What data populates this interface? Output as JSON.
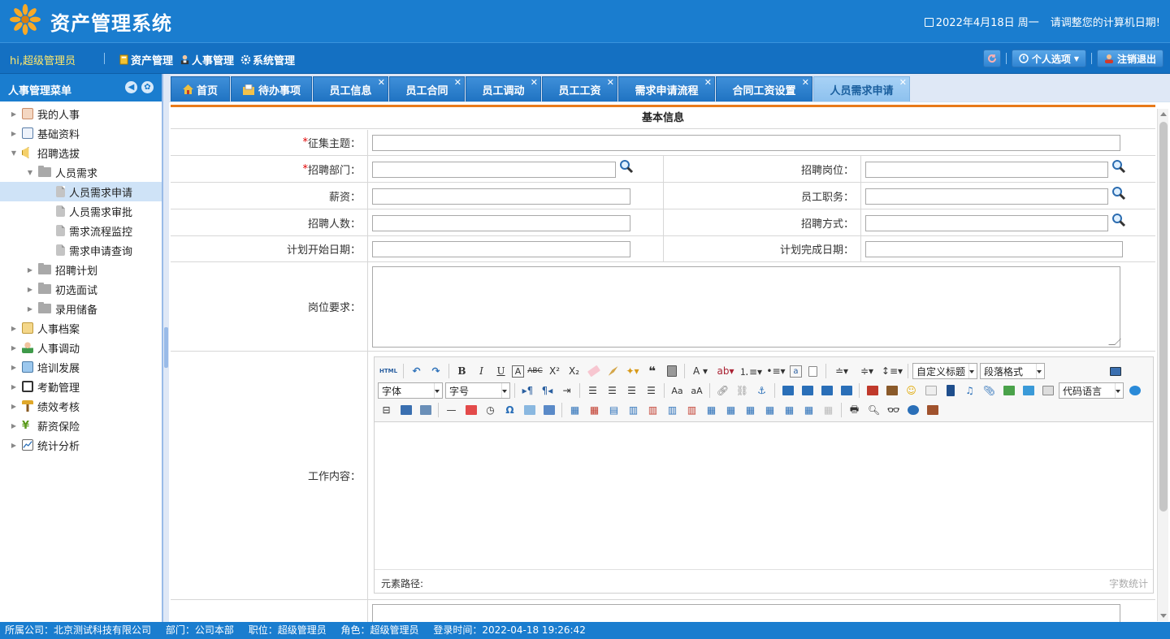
{
  "header": {
    "app_title": "资产管理系统",
    "date": "2022年4月18日 周一",
    "date_hint": "请调整您的计算机日期!"
  },
  "navbar": {
    "greeting": "hi,超级管理员",
    "links": [
      "资产管理",
      "人事管理",
      "系统管理"
    ],
    "personal_options": "个人选项",
    "logout": "注销退出"
  },
  "sidebar": {
    "title": "人事管理菜单",
    "items": [
      {
        "label": "我的人事",
        "icon": "person-card-icon"
      },
      {
        "label": "基础资料",
        "icon": "id-card-icon"
      },
      {
        "label": "招聘选拔",
        "icon": "megaphone-icon"
      },
      {
        "label": "人员需求",
        "icon": "folder-icon"
      },
      {
        "label": "人员需求申请",
        "icon": "page-icon"
      },
      {
        "label": "人员需求审批",
        "icon": "page-icon"
      },
      {
        "label": "需求流程监控",
        "icon": "page-icon"
      },
      {
        "label": "需求申请查询",
        "icon": "page-icon"
      },
      {
        "label": "招聘计划",
        "icon": "folder-icon"
      },
      {
        "label": "初选面试",
        "icon": "folder-icon"
      },
      {
        "label": "录用储备",
        "icon": "folder-icon"
      },
      {
        "label": "人事档案",
        "icon": "archive-icon"
      },
      {
        "label": "人事调动",
        "icon": "people-icon"
      },
      {
        "label": "培训发展",
        "icon": "monitor-icon"
      },
      {
        "label": "考勤管理",
        "icon": "calendar-icon"
      },
      {
        "label": "绩效考核",
        "icon": "signpost-icon"
      },
      {
        "label": "薪资保险",
        "icon": "yen-icon"
      },
      {
        "label": "统计分析",
        "icon": "chart-icon"
      }
    ]
  },
  "tabs": [
    "首页",
    "待办事项",
    "员工信息",
    "员工合同",
    "员工调动",
    "员工工资",
    "需求申请流程",
    "合同工资设置",
    "人员需求申请"
  ],
  "form": {
    "section_title": "基本信息",
    "required_mark": "*",
    "labels": {
      "subject": "征集主题：",
      "dept": "招聘部门：",
      "position": "招聘岗位：",
      "salary": "薪资：",
      "duty": "员工职务：",
      "count": "招聘人数：",
      "method": "招聘方式：",
      "start_date": "计划开始日期：",
      "end_date": "计划完成日期：",
      "requirements": "岗位要求：",
      "work_content": "工作内容："
    }
  },
  "editor": {
    "html_btn": "HTML",
    "font_family": "字体",
    "font_size": "字号",
    "custom_title": "自定义标题",
    "paragraph_format": "段落格式",
    "code_lang": "代码语言",
    "element_path": "元素路径:",
    "word_count": "字数统计"
  },
  "statusbar": {
    "company": "所属公司：北京测试科技有限公司",
    "dept": "部门：公司本部",
    "title": "职位：超级管理员",
    "role": "角色：超级管理员",
    "login_time": "登录时间：2022-04-18 19:26:42"
  },
  "colors": {
    "primary": "#1a7dcf",
    "accent_line": "#e87a1a",
    "required": "#e00000"
  }
}
